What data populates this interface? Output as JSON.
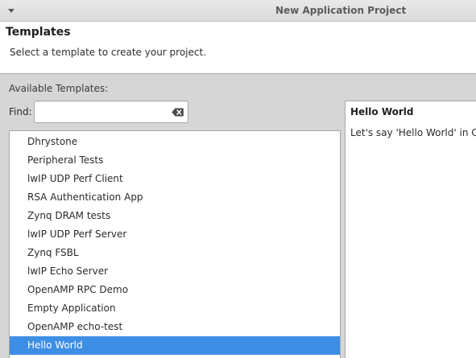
{
  "window": {
    "title": "New Application Project",
    "menu_icon": "chevron-down-icon"
  },
  "header": {
    "title": "Templates",
    "description": "Select a template to create your project."
  },
  "templates": {
    "section_label": "Available Templates:",
    "find_label": "Find:",
    "find_value": "",
    "find_placeholder": "",
    "clear_icon": "clear-text-icon",
    "items": [
      {
        "label": "Dhrystone",
        "selected": false
      },
      {
        "label": "Peripheral Tests",
        "selected": false
      },
      {
        "label": "lwIP UDP Perf Client",
        "selected": false
      },
      {
        "label": "RSA Authentication App",
        "selected": false
      },
      {
        "label": "Zynq DRAM tests",
        "selected": false
      },
      {
        "label": "lwIP UDP Perf Server",
        "selected": false
      },
      {
        "label": "Zynq FSBL",
        "selected": false
      },
      {
        "label": "lwIP Echo Server",
        "selected": false
      },
      {
        "label": "OpenAMP RPC Demo",
        "selected": false
      },
      {
        "label": "Empty Application",
        "selected": false
      },
      {
        "label": "OpenAMP echo-test",
        "selected": false
      },
      {
        "label": "Hello World",
        "selected": true
      }
    ],
    "selection_color": "#3d8ee5"
  },
  "description_panel": {
    "title": "Hello World",
    "text": "Let's say 'Hello World' in C."
  }
}
